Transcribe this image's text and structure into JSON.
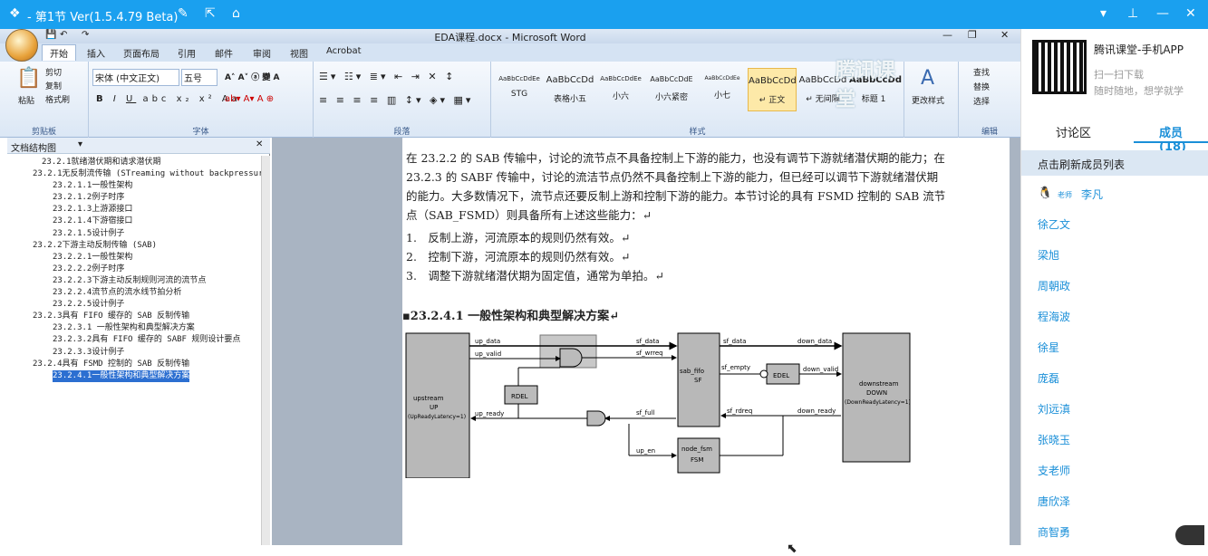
{
  "titlebar": {
    "title": "- 第1节 Ver(1.5.4.79 Beta)"
  },
  "word": {
    "title": "EDA课程.docx - Microsoft Word",
    "tabs": [
      "开始",
      "插入",
      "页面布局",
      "引用",
      "邮件",
      "审阅",
      "视图",
      "Acrobat"
    ],
    "clipboard": {
      "paste": "粘贴",
      "cut": "剪切",
      "copy": "复制",
      "format": "格式刷",
      "label": "剪贴板"
    },
    "font": {
      "name": "宋体 (中文正文)",
      "size": "五号",
      "label": "字体"
    },
    "para_label": "段落",
    "styles": [
      {
        "preview": "AaBbCcDdEe",
        "name": "STG"
      },
      {
        "preview": "AaBbCcDd",
        "name": "表格小五"
      },
      {
        "preview": "AaBbCcDdEe",
        "name": "小六"
      },
      {
        "preview": "AaBbCcDdE",
        "name": "小六紧密"
      },
      {
        "preview": "AaBbCcDdEe",
        "name": "小七"
      },
      {
        "preview": "AaBbCcDd",
        "name": "↵ 正文"
      },
      {
        "preview": "AaBbCcDd",
        "name": "↵ 无间隔"
      },
      {
        "preview": "AaBbCcDd",
        "name": "标题 1"
      }
    ],
    "styles_label": "样式",
    "change_styles": "更改样式",
    "edit": {
      "find": "查找",
      "replace": "替换",
      "select": "选择",
      "label": "编辑"
    },
    "watermark": "腾讯课堂"
  },
  "nav": {
    "title": "文档结构图",
    "items": [
      "23.2.1就绪潜伏期和请求潜伏期",
      "23.2.1无反制流传输 (STreaming without backpressure",
      "23.2.1.1一般性架构",
      "23.2.1.2例子时序",
      "23.2.1.3上游源接口",
      "23.2.1.4下游宿接口",
      "23.2.1.5设计例子",
      "23.2.2下游主动反制传输 (SAB)",
      "23.2.2.1一般性架构",
      "23.2.2.2例子时序",
      "23.2.2.3下游主动反制规则河流的流节点",
      "23.2.2.4流节点的流水线节拍分析",
      "23.2.2.5设计例子",
      "23.2.3具有 FIFO 缓存的 SAB 反制传输",
      "23.2.3.1 一般性架构和典型解决方案",
      "23.2.3.2具有 FIFO 缓存的 SABF 规则设计要点",
      "23.2.3.3设计例子",
      "23.2.4具有 FSMD 控制的 SAB 反制传输",
      "23.2.4.1一般性架构和典型解决方案"
    ]
  },
  "doc": {
    "para": "在 23.2.2 的 SAB 传输中，讨论的流节点不具备控制上下游的能力，也没有调节下游就绪潜伏期的能力；在 23.2.3 的 SABF 传输中，讨论的流洁节点仍然不具备控制上下游的能力，但已经可以调节下游就绪潜伏期的能力。大多数情况下，流节点还要反制上游和控制下游的能力。本节讨论的具有 FSMD 控制的 SAB 流节点（SAB_FSMD）则具备所有上述这些能力：↵",
    "list": [
      "1.　反制上游，河流原本的规则仍然有效。↵",
      "2.　控制下游，河流原本的规则仍然有效。↵",
      "3.　调整下游就绪潜伏期为固定值，通常为单拍。↵"
    ],
    "heading": "▪23.2.4.1 一般性架构和典型解决方案↵",
    "diagram": {
      "upstream": [
        "upstream",
        "UP",
        "(UpReadyLatency=1)"
      ],
      "sff": [
        "sab_fifo",
        "SF"
      ],
      "downstream": [
        "downstream",
        "DOWN",
        "(DownReadyLatency=1)"
      ],
      "fsm": [
        "node_fsm",
        "FSM"
      ],
      "rdel": "RDEL",
      "edel": "EDEL",
      "signals": [
        "up_data",
        "up_valid",
        "up_ready",
        "sf_data",
        "sf_wrreq",
        "sf_full",
        "sf_data",
        "sf_empty",
        "sf_rdreq",
        "down_data",
        "down_valid",
        "down_ready",
        "up_en"
      ]
    }
  },
  "panel": {
    "app": "腾讯课堂-手机APP",
    "scan": "扫一扫下载",
    "slogan": "随时随地，想学就学",
    "tab_discuss": "讨论区",
    "tab_members": "成员(18)",
    "refresh": "点击刷新成员列表",
    "teacher_badge": "老师",
    "teacher": "李凡",
    "members": [
      "徐乙文",
      "梁旭",
      "周朝政",
      "程海波",
      "徐星",
      "庞磊",
      "刘远滇",
      "张晓玉",
      "支老师",
      "唐欣泽",
      "商智勇"
    ]
  }
}
